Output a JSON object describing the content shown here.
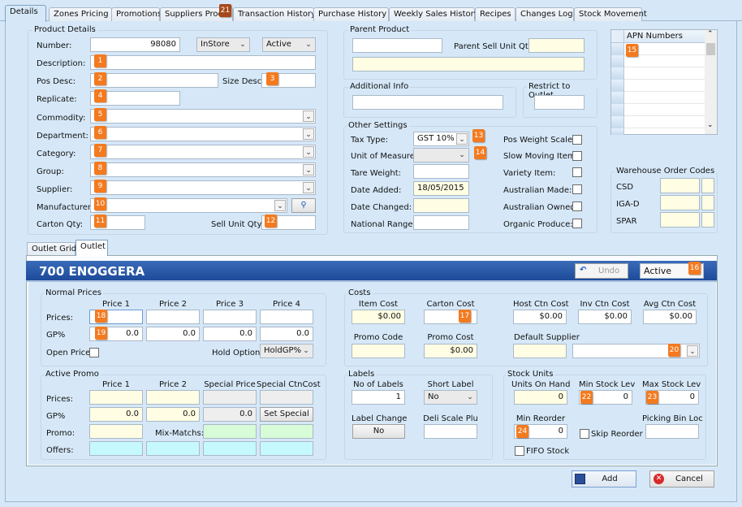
{
  "tabs": [
    "Details",
    "Zones Pricing",
    "Promotions",
    "Suppliers Produ",
    "Transaction History",
    "Purchase History",
    "Weekly Sales History",
    "Recipes",
    "Changes Log",
    "Stock Movement"
  ],
  "product_details": {
    "group_label": "Product Details",
    "number_label": "Number:",
    "number_value": "98080",
    "store_select": "InStore",
    "status_select": "Active",
    "description_label": "Description:",
    "pos_desc_label": "Pos Desc:",
    "size_desc_label": "Size Desc:",
    "replicate_label": "Replicate:",
    "commodity_label": "Commodity:",
    "department_label": "Department:",
    "category_label": "Category:",
    "group_field_label": "Group:",
    "supplier_label": "Supplier:",
    "manufacturer_label": "Manufacturer:",
    "carton_qty_label": "Carton Qty:",
    "sell_unit_qty_label": "Sell Unit Qty:"
  },
  "parent_product": {
    "group_label": "Parent Product",
    "parent_sell_unit_qty_label": "Parent Sell Unit Qty:"
  },
  "additional_info": {
    "group_label": "Additional Info"
  },
  "restrict_outlet": {
    "group_label": "Restrict to Outlet"
  },
  "other_settings": {
    "group_label": "Other Settings",
    "tax_type_label": "Tax Type:",
    "tax_type_value": "GST 10%",
    "uom_label": "Unit of Measure:",
    "tare_weight_label": "Tare Weight:",
    "date_added_label": "Date Added:",
    "date_added_value": "18/05/2015",
    "date_changed_label": "Date Changed:",
    "national_range_label": "National Range:",
    "checks": [
      "Pos Weight Scales:",
      "Slow Moving Item:",
      "Variety Item:",
      "Australian Made:",
      "Australian Owned:",
      "Organic Produce:"
    ]
  },
  "apn": {
    "header": "APN Numbers"
  },
  "warehouse": {
    "group_label": "Warehouse Order Codes",
    "rows": [
      "CSD",
      "IGA-D",
      "SPAR"
    ]
  },
  "subtabs": [
    "Outlet Grid",
    "Outlet"
  ],
  "outlet": {
    "title": "700  ENOGGERA",
    "undo_label": "Undo",
    "status_value": "Active"
  },
  "normal_prices": {
    "group_label": "Normal Prices",
    "columns": [
      "Price 1",
      "Price 2",
      "Price 3",
      "Price 4"
    ],
    "prices_label": "Prices:",
    "gp_label": "GP%",
    "gp_values": [
      "0.0",
      "0.0",
      "0.0",
      "0.0"
    ],
    "open_price_label": "Open Price",
    "hold_option_label": "Hold Option:",
    "hold_option_value": "HoldGP%"
  },
  "costs": {
    "group_label": "Costs",
    "item_cost_label": "Item Cost",
    "item_cost_value": "$0.00",
    "carton_cost_label": "Carton Cost",
    "host_ctn_label": "Host Ctn Cost",
    "host_ctn_value": "$0.00",
    "inv_ctn_label": "Inv Ctn Cost",
    "inv_ctn_value": "$0.00",
    "avg_ctn_label": "Avg Ctn Cost",
    "avg_ctn_value": "$0.00",
    "promo_code_label": "Promo Code",
    "promo_cost_label": "Promo Cost",
    "promo_cost_value": "$0.00",
    "default_supplier_label": "Default Supplier"
  },
  "active_promo": {
    "group_label": "Active Promo",
    "columns": [
      "Price 1",
      "Price 2",
      "Special Price",
      "Special CtnCost"
    ],
    "prices_label": "Prices:",
    "gp_label": "GP%",
    "promo_label": "Promo:",
    "offers_label": "Offers:",
    "gp_values": [
      "0.0",
      "0.0",
      "0.0"
    ],
    "set_special_label": "Set Special",
    "mix_matchs_label": "Mix-Matchs:"
  },
  "labels": {
    "group_label": "Labels",
    "no_labels_label": "No of Labels",
    "no_labels_value": "1",
    "short_label_label": "Short Label",
    "short_label_value": "No",
    "label_change_label": "Label Change",
    "label_change_value": "No",
    "deli_scale_label": "Deli Scale Plu"
  },
  "stock_units": {
    "group_label": "Stock Units",
    "on_hand_label": "Units On Hand",
    "on_hand_value": "0",
    "min_stock_label": "Min Stock Lev",
    "min_stock_value": "0",
    "max_stock_label": "Max Stock Lev",
    "max_stock_value": "0",
    "min_reorder_label": "Min Reorder",
    "min_reorder_value": "0",
    "skip_reorder_label": "Skip Reorder",
    "picking_bin_label": "Picking Bin Loc",
    "fifo_label": "FIFO Stock"
  },
  "footer": {
    "add_label": "Add",
    "cancel_label": "Cancel"
  },
  "badges": [
    "1",
    "2",
    "3",
    "4",
    "5",
    "6",
    "7",
    "8",
    "9",
    "10",
    "11",
    "12",
    "13",
    "14",
    "15",
    "16",
    "17",
    "18",
    "19",
    "20",
    "21",
    "22",
    "23",
    "24"
  ]
}
